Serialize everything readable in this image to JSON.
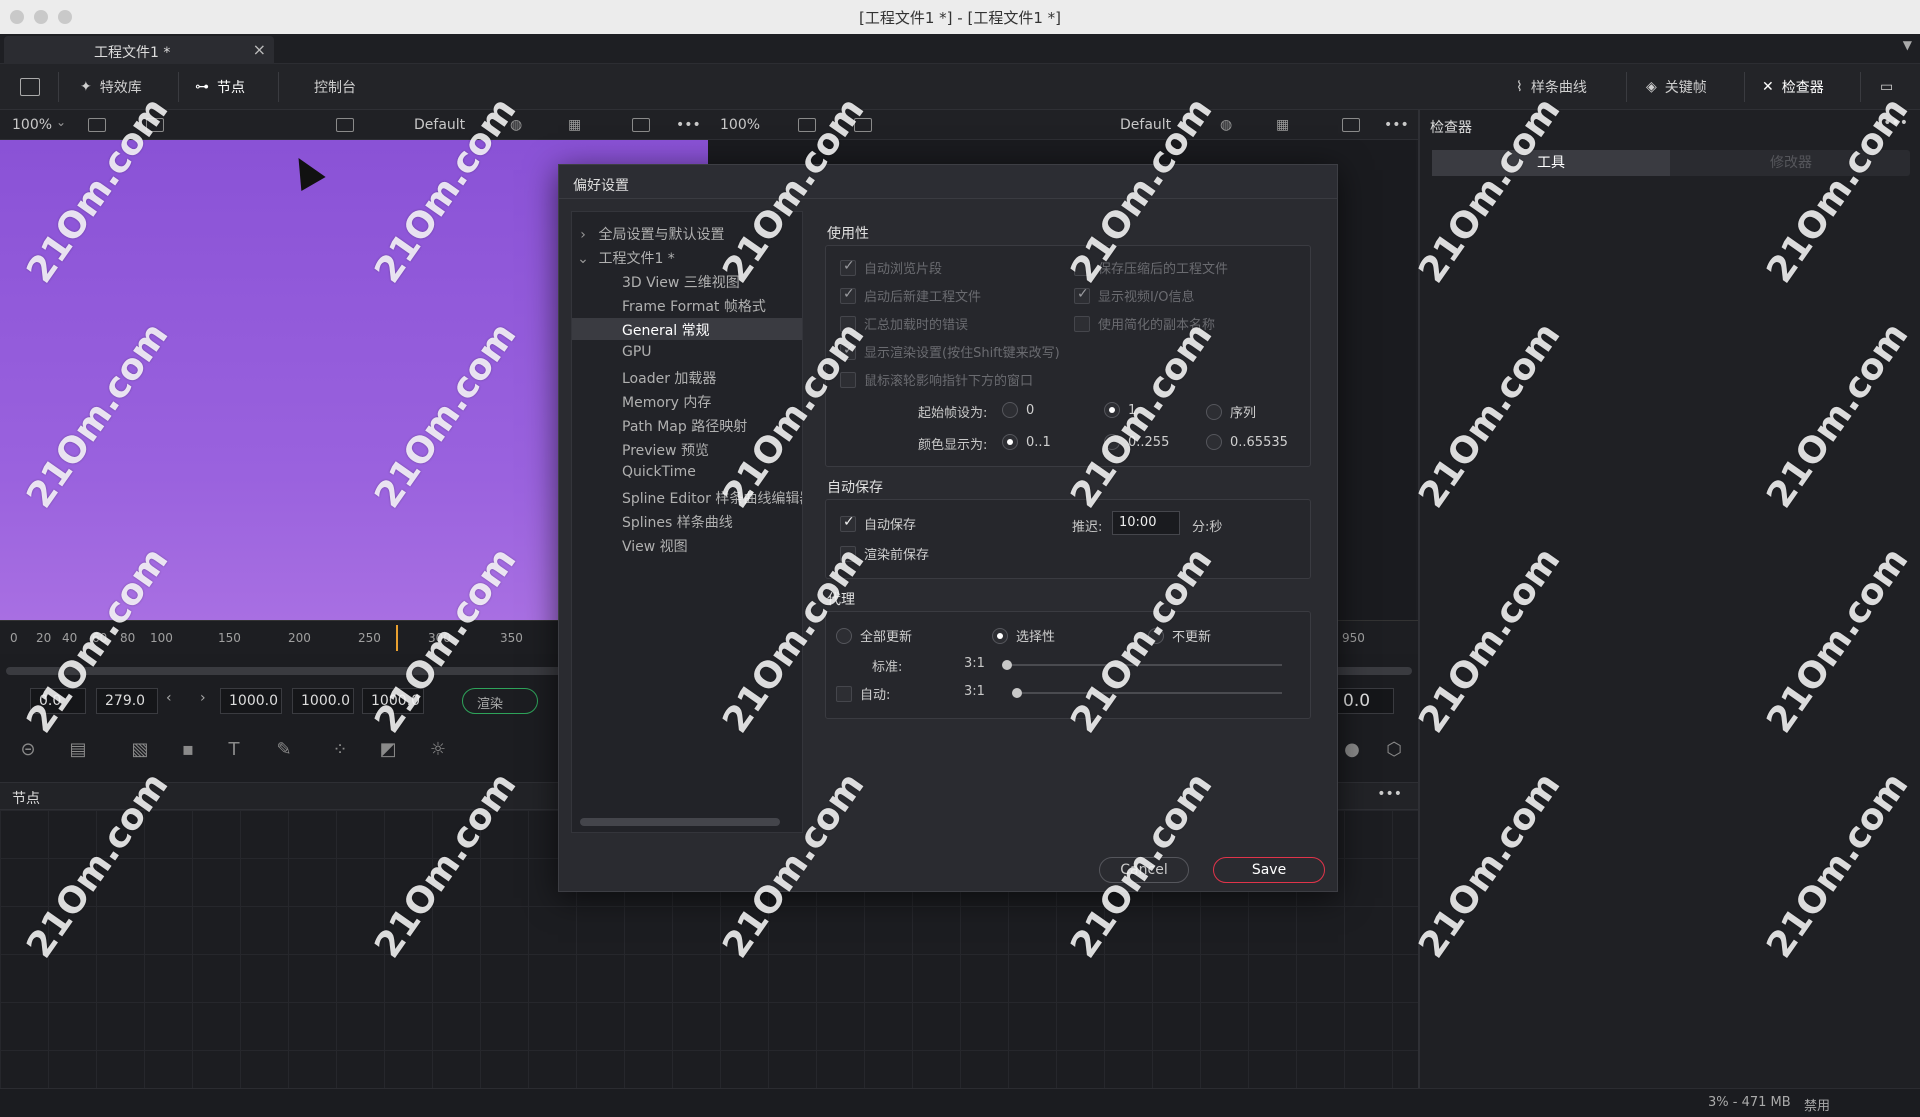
{
  "window": {
    "title": "[工程文件1 *] - [工程文件1 *]"
  },
  "tabs": [
    {
      "label": "工程文件1 *",
      "close": "×"
    }
  ],
  "toolbar": {
    "effects_label": "特效库",
    "nodes_label": "节点",
    "console_label": "控制台",
    "spline_label": "样条曲线",
    "keyframes_label": "关键帧",
    "inspector_label": "检查器"
  },
  "viewer_left": {
    "zoom": "100%",
    "lut": "Default"
  },
  "viewer_right": {
    "zoom": "100%",
    "lut": "Default"
  },
  "ruler": {
    "ticks": [
      "0",
      "20",
      "40",
      "60",
      "80",
      "100",
      "150",
      "200",
      "250",
      "300",
      "350"
    ],
    "right_tick": "950"
  },
  "timecode": {
    "start": "0.0",
    "current": "279.0",
    "render_start": "1000.0",
    "render_end": "1000.0",
    "global_end": "1000.0",
    "render_button": "渲染",
    "right_value": "0.0"
  },
  "nodes_panel": {
    "title": "节点"
  },
  "inspector": {
    "title": "检查器",
    "tab_tools": "工具",
    "tab_modifiers": "修改器"
  },
  "status": {
    "memory": "3% - 471 MB",
    "state": "禁用"
  },
  "dialog": {
    "title": "偏好设置",
    "tree": {
      "global": "全局设置与默认设置",
      "project": "工程文件1 *",
      "items": [
        "3D View 三维视图",
        "Frame Format 帧格式",
        "General 常规",
        "GPU",
        "Loader 加载器",
        "Memory 内存",
        "Path Map 路径映射",
        "Preview 预览",
        "QuickTime",
        "Spline Editor 样条曲线编辑器",
        "Splines 样条曲线",
        "View 视图"
      ],
      "selected": "General 常规"
    },
    "usability": {
      "title": "使用性",
      "auto_browse": "自动浏览片段",
      "save_compressed": "保存压缩后的工程文件",
      "new_project_on_start": "启动后新建工程文件",
      "show_video_io": "显示视频I/O信息",
      "summarize_load_errors": "汇总加载时的错误",
      "simplified_copy_names": "使用简化的副本名称",
      "show_render_settings": "显示渲染设置(按住Shift键来改写)",
      "wheel_affects_window": "鼠标滚轮影响指针下方的窗口",
      "start_frame_label": "起始帧设为:",
      "start_frame_options": [
        "0",
        "1",
        "序列"
      ],
      "color_display_label": "颜色显示为:",
      "color_display_options": [
        "0..1",
        "0..255",
        "0..65535"
      ]
    },
    "autosave": {
      "title": "自动保存",
      "autosave_label": "自动保存",
      "save_before_render": "渲染前保存",
      "delay_label": "推迟:",
      "delay_value": "10:00",
      "delay_unit": "分:秒"
    },
    "proxy": {
      "title": "代理",
      "update_all": "全部更新",
      "selective": "选择性",
      "no_update": "不更新",
      "standard_label": "标准:",
      "standard_value": "3:1",
      "standard_level": 0.0,
      "auto_label": "自动:",
      "auto_value": "3:1",
      "auto_level": 0.0
    },
    "buttons": {
      "cancel": "Cancel",
      "save": "Save"
    }
  },
  "watermark": "21Om.com",
  "colors": {
    "viewer_purple": "#8a52d6",
    "save_accent": "#e0344a"
  }
}
